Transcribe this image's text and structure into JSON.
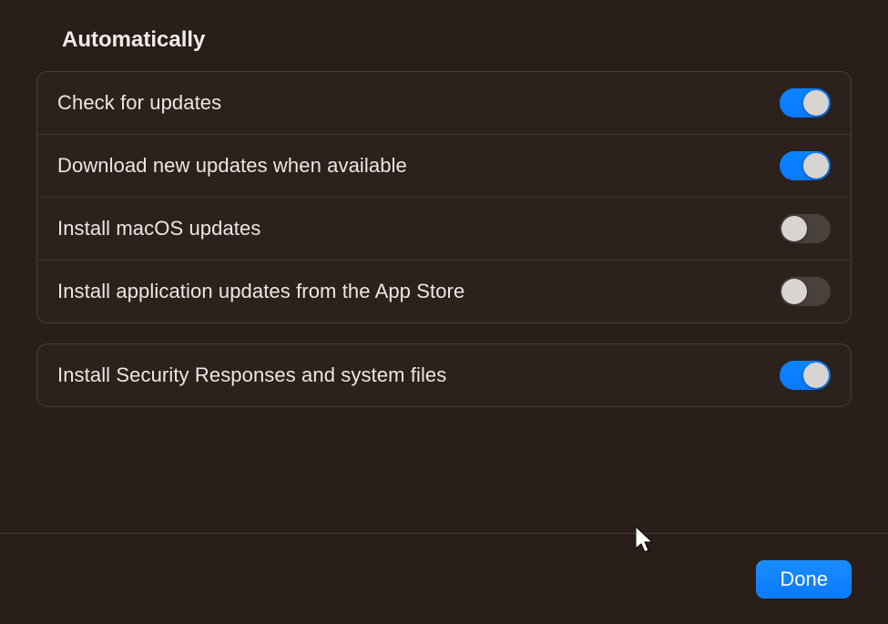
{
  "header": {
    "title": "Automatically"
  },
  "panel1": {
    "rows": [
      {
        "label": "Check for updates",
        "on": true
      },
      {
        "label": "Download new updates when available",
        "on": true
      },
      {
        "label": "Install macOS updates",
        "on": false
      },
      {
        "label": "Install application updates from the App Store",
        "on": false
      }
    ]
  },
  "panel2": {
    "rows": [
      {
        "label": "Install Security Responses and system files",
        "on": true
      }
    ]
  },
  "footer": {
    "done_label": "Done"
  }
}
